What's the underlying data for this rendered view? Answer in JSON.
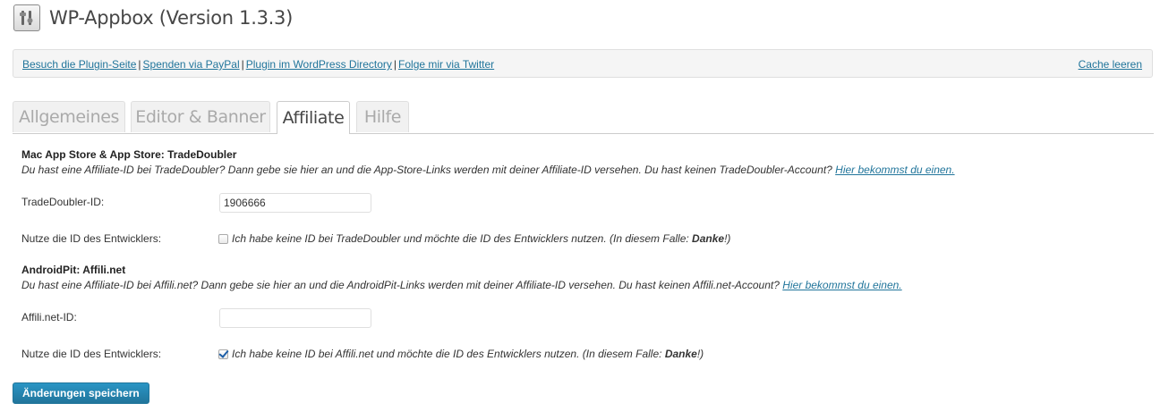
{
  "header": {
    "title": "WP-Appbox (Version 1.3.3)",
    "icon": "plugin-tools-icon"
  },
  "linkbar": {
    "links": [
      "Besuch die Plugin-Seite",
      "Spenden via PayPal",
      "Plugin im WordPress Directory",
      "Folge mir via Twitter"
    ],
    "separator": "|",
    "cache_clear": "Cache leeren"
  },
  "tabs": [
    {
      "label": "Allgemeines",
      "active": false
    },
    {
      "label": "Editor & Banner",
      "active": false
    },
    {
      "label": "Affiliate",
      "active": true
    },
    {
      "label": "Hilfe",
      "active": false
    }
  ],
  "tradedoubler": {
    "title": "Mac App Store & App Store: TradeDoubler",
    "description": "Du hast eine Affiliate-ID bei TradeDoubler? Dann gebe sie hier an und die App-Store-Links werden mit deiner Affiliate-ID versehen. Du hast keinen TradeDoubler-Account?",
    "description_link": "Hier bekommst du einen.",
    "id_label": "TradeDoubler-ID:",
    "id_value": "1906666",
    "dev_label": "Nutze die ID des Entwicklers:",
    "dev_checked": false,
    "dev_text": "Ich habe keine ID bei TradeDoubler und möchte die ID des Entwicklers nutzen. (In diesem Falle:",
    "dev_bold": "Danke",
    "dev_end": "!)"
  },
  "affilinet": {
    "title": "AndroidPit: Affili.net",
    "description": "Du hast eine Affiliate-ID bei Affili.net? Dann gebe sie hier an und die AndroidPit-Links werden mit deiner Affiliate-ID versehen. Du hast keinen Affili.net-Account?",
    "description_link": "Hier bekommst du einen.",
    "id_label": "Affili.net-ID:",
    "id_value": "",
    "dev_label": "Nutze die ID des Entwicklers:",
    "dev_checked": true,
    "dev_text": "Ich habe keine ID bei Affili.net und möchte die ID des Entwicklers nutzen. (In diesem Falle:",
    "dev_bold": "Danke",
    "dev_end": "!)"
  },
  "save_label": "Änderungen speichern"
}
